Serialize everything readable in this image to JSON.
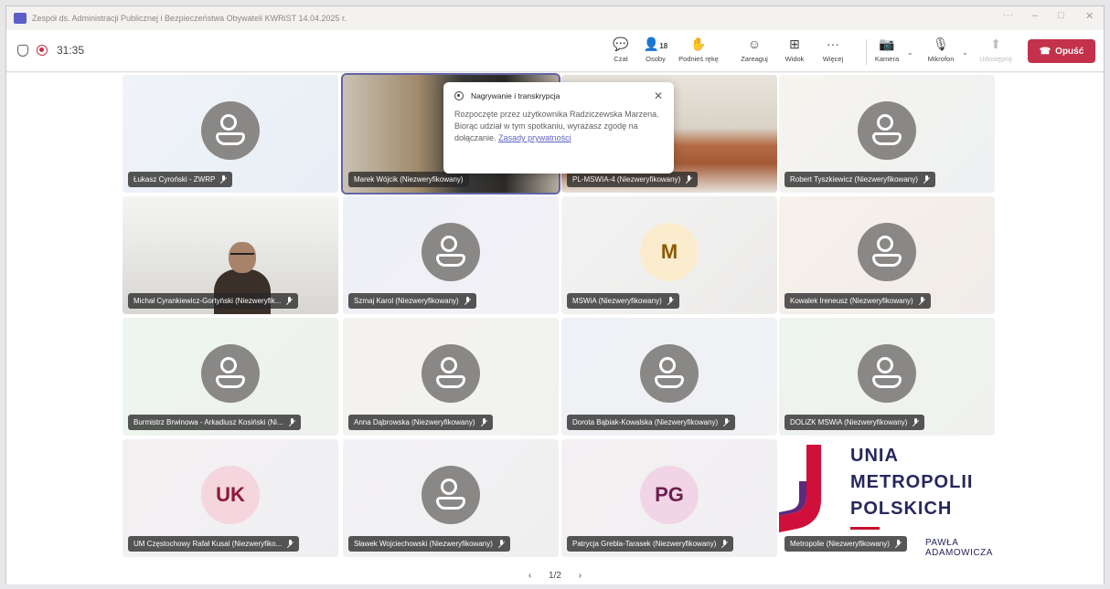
{
  "window": {
    "title": "Zespół ds. Administracji Publicznej i Bezpieczeństwa Obywateli KWRiST 14.04.2025 r.",
    "controls": [
      "···",
      "–",
      "□",
      "✕"
    ]
  },
  "toolbar": {
    "timer": "31:35",
    "buttons": [
      {
        "label": "Czat",
        "icon": "chat-icon",
        "glyph": "💬"
      },
      {
        "label": "Osoby",
        "icon": "people-icon",
        "glyph": "👤",
        "count": "18"
      },
      {
        "label": "Podnieś rękę",
        "icon": "raise-hand-icon",
        "glyph": "✋"
      },
      {
        "label": "Zareaguj",
        "icon": "react-icon",
        "glyph": "☺"
      },
      {
        "label": "Widok",
        "icon": "view-icon",
        "glyph": "⊞"
      },
      {
        "label": "Więcej",
        "icon": "more-icon",
        "glyph": "···"
      },
      {
        "label": "Kamera",
        "icon": "camera-off-icon",
        "glyph": "📷"
      },
      {
        "label": "Mikrofon",
        "icon": "mic-off-icon",
        "glyph": "🎙"
      },
      {
        "label": "Udostępnij",
        "icon": "share-icon",
        "glyph": "⬆"
      }
    ],
    "leave_label": "Opuść",
    "leave_color": "#c4314b"
  },
  "popup": {
    "title": "Nagrywanie i transkrypcja",
    "body": "Rozpoczęte przez użytkownika Radziczewska Marzena. Biorąc udział w tym spotkaniu, wyrażasz zgodę na dołączanie.",
    "link": "Zasady prywatności"
  },
  "participants": [
    {
      "name": "Łukasz Cyroński - ZWRP",
      "kind": "icon"
    },
    {
      "name": "Marek Wójcik (Niezweryfikowany)",
      "kind": "video"
    },
    {
      "name": "PL-MSWIA-4 (Niezweryfikowany)",
      "kind": "video"
    },
    {
      "name": "Robert Tyszkiewicz (Niezweryfikowany)",
      "kind": "icon"
    },
    {
      "name": "Michał Cyrankiewicz-Gortyński (Niezweryfik...",
      "kind": "video"
    },
    {
      "name": "Szmaj Karol (Niezweryfikowany)",
      "kind": "icon"
    },
    {
      "name": "MSWiA (Niezweryfikowany)",
      "kind": "initials",
      "initials": "M"
    },
    {
      "name": "Kowalek Ireneusz (Niezweryfikowany)",
      "kind": "icon"
    },
    {
      "name": "Burmistrz Brwinowa - Arkadiusz Kosiński (Ni...",
      "kind": "icon"
    },
    {
      "name": "Anna Dąbrowska (Niezweryfikowany)",
      "kind": "icon"
    },
    {
      "name": "Dorota Bąbiak-Kowalska (Niezweryfikowany)",
      "kind": "icon"
    },
    {
      "name": "DOLiZK MSWiA (Niezweryfikowany)",
      "kind": "icon"
    },
    {
      "name": "UM Częstochowy Rafał Kusal (Niezweryfiko...",
      "kind": "initials",
      "initials": "UK"
    },
    {
      "name": "Sławek Wojciechowski (Niezweryfikowany)",
      "kind": "icon"
    },
    {
      "name": "Patrycja Grebla-Tarasek (Niezweryfikowany)",
      "kind": "initials",
      "initials": "PG"
    },
    {
      "name": "Metropolie (Niezweryfikowany)",
      "kind": "logo"
    }
  ],
  "logo": {
    "lines": [
      "UNIA",
      "METROPOLII",
      "POLSKICH"
    ],
    "sub": "PAWŁA ADAMOWICZA"
  },
  "pager": {
    "prev": "‹",
    "label": "1/2",
    "next": "›"
  }
}
